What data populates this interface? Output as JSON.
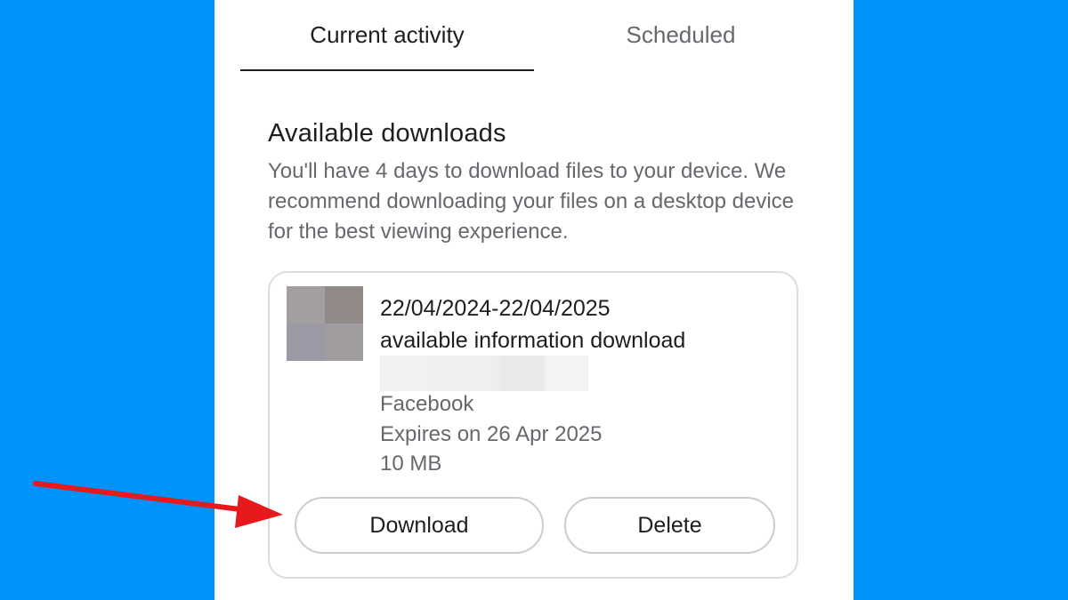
{
  "tabs": [
    {
      "label": "Current activity",
      "active": true
    },
    {
      "label": "Scheduled",
      "active": false
    }
  ],
  "section": {
    "title": "Available downloads",
    "description": "You'll have 4 days to download files to your device. We recommend downloading your files on a desktop device for the best viewing experience."
  },
  "file": {
    "date_range": "22/04/2024-22/04/2025",
    "name": "available information download",
    "source": "Facebook",
    "expires": "Expires on 26 Apr 2025",
    "size": "10 MB"
  },
  "actions": {
    "download_label": "Download",
    "delete_label": "Delete"
  },
  "colors": {
    "background": "#0092fb",
    "panel": "#ffffff",
    "primary_text": "#1c1e21",
    "secondary_text": "#65686c",
    "arrow": "#e8191d"
  }
}
